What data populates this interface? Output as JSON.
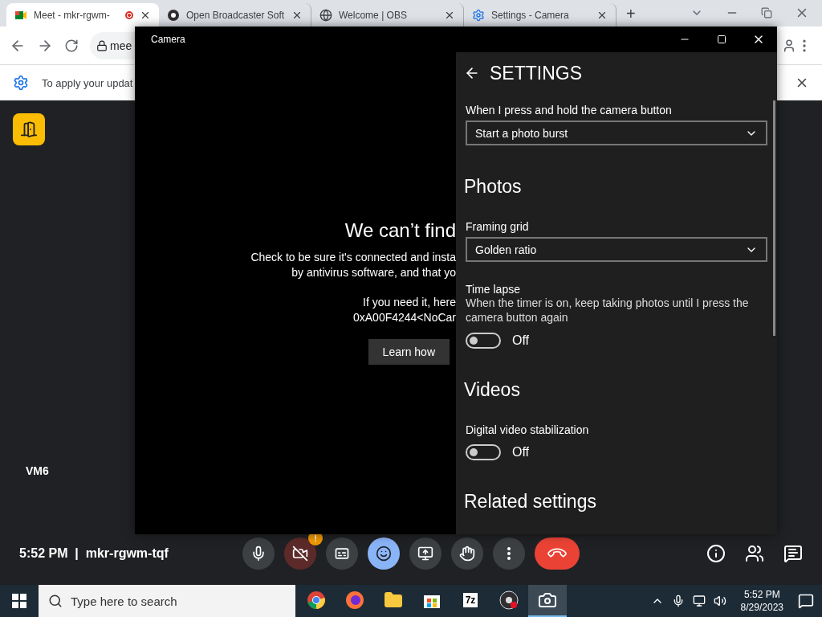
{
  "browser": {
    "tabs": [
      {
        "title": "Meet - mkr-rgwm-",
        "kind": "meet",
        "recording": true,
        "selected": true
      },
      {
        "title": "Open Broadcaster Soft",
        "kind": "obs",
        "recording": false,
        "selected": false
      },
      {
        "title": "Welcome | OBS",
        "kind": "web",
        "recording": false,
        "selected": false
      },
      {
        "title": "Settings - Camera",
        "kind": "settings",
        "recording": false,
        "selected": false
      }
    ],
    "new_tab": "+",
    "address": "mee",
    "infobar": "To apply your updat"
  },
  "meet": {
    "tile_label": "VM6",
    "time": "5:52 PM",
    "separator": "|",
    "meeting_code": "mkr-rgwm-tqf",
    "controls": [
      {
        "kind": "mic",
        "off": false,
        "highlighted": false
      },
      {
        "kind": "camera",
        "off": true,
        "highlighted": false,
        "badge": "!"
      },
      {
        "kind": "captions",
        "off": false,
        "highlighted": false
      },
      {
        "kind": "emoji",
        "off": false,
        "highlighted": true
      },
      {
        "kind": "present",
        "off": false,
        "highlighted": false
      },
      {
        "kind": "hand",
        "off": false,
        "highlighted": false
      },
      {
        "kind": "more",
        "off": false,
        "highlighted": false
      },
      {
        "kind": "leave",
        "off": false,
        "highlighted": false
      }
    ],
    "side_buttons": [
      {
        "kind": "info"
      },
      {
        "kind": "people"
      },
      {
        "kind": "chat"
      }
    ]
  },
  "camera_window": {
    "title": "Camera",
    "error": {
      "heading": "We can’t find",
      "lines": [
        "Check to be sure it's connected and insta",
        "by antivirus software, and that yo"
      ],
      "code_lines": [
        "If you need it, here",
        "0xA00F4244<NoCar"
      ],
      "button": "Learn how"
    },
    "settings": {
      "title": "SETTINGS",
      "items": [
        {
          "kind": "dropdown",
          "label": "When I press and hold the camera button",
          "value": "Start a photo burst"
        },
        {
          "kind": "heading",
          "label": "Photos"
        },
        {
          "kind": "dropdown",
          "label": "Framing grid",
          "value": "Golden ratio"
        },
        {
          "kind": "toggle",
          "label": "Time lapse",
          "description": "When the timer is on, keep taking photos until I press the camera button again",
          "on": false,
          "state_label": "Off"
        },
        {
          "kind": "heading",
          "label": "Videos"
        },
        {
          "kind": "toggle",
          "label": "Digital video stabilization",
          "on": false,
          "state_label": "Off"
        },
        {
          "kind": "heading",
          "label": "Related settings"
        }
      ]
    }
  },
  "taskbar": {
    "search_placeholder": "Type here to search",
    "apps": [
      {
        "kind": "chrome",
        "selected": false
      },
      {
        "kind": "firefox",
        "selected": false
      },
      {
        "kind": "explorer",
        "selected": false
      },
      {
        "kind": "store",
        "selected": false
      },
      {
        "kind": "archiver",
        "label": "7z",
        "selected": false
      },
      {
        "kind": "obs",
        "selected": false
      },
      {
        "kind": "camera",
        "selected": true
      }
    ],
    "time": "5:52 PM",
    "date": "8/29/2023"
  }
}
